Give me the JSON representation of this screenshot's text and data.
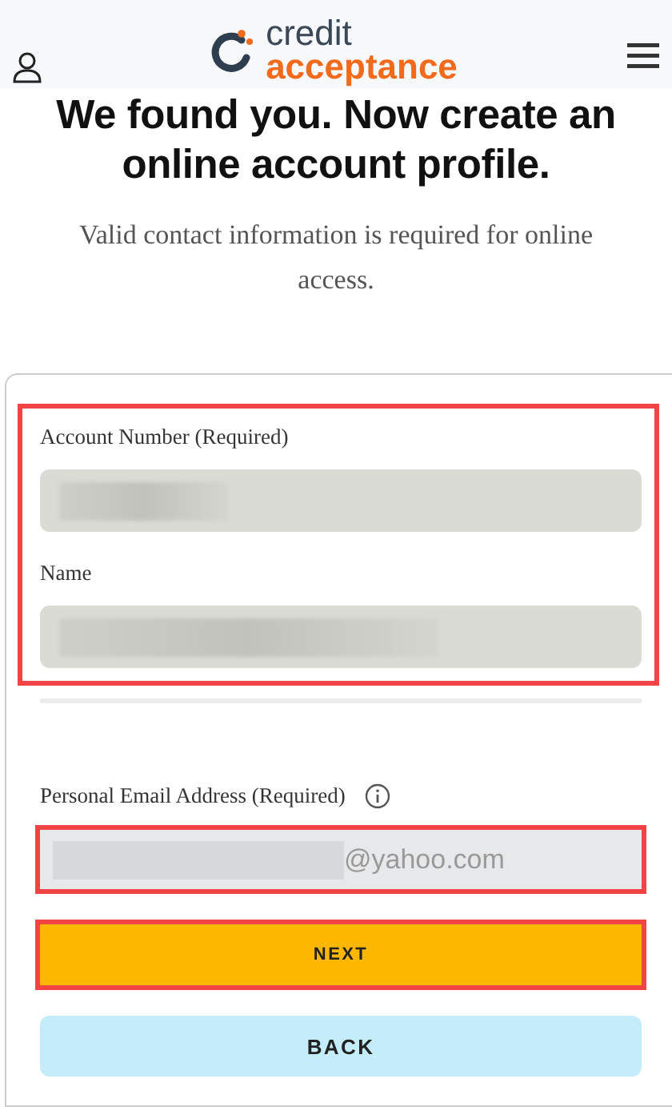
{
  "header": {
    "logo": {
      "top": "credit",
      "bottom": "acceptance"
    }
  },
  "heading": "We found you. Now create an online account profile.",
  "subtext": "Valid contact information is required for online access.",
  "account_group": {
    "highlighted": true,
    "fields": [
      {
        "label": "Account Number (Required)",
        "redacted": true
      },
      {
        "label": "Name",
        "redacted": true
      }
    ]
  },
  "email": {
    "label": "Personal Email Address (Required)",
    "domain": "@yahoo.com",
    "redacted": true,
    "highlighted": true
  },
  "buttons": [
    {
      "label": "NEXT",
      "kind": "primary",
      "highlighted": true
    },
    {
      "label": "BACK",
      "kind": "secondary",
      "highlighted": false
    }
  ]
}
